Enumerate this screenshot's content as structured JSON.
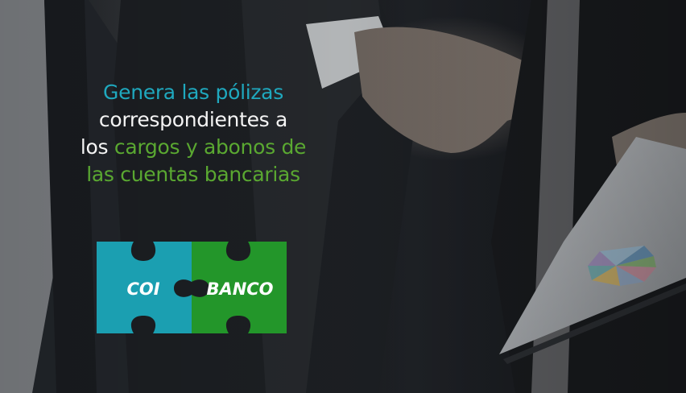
{
  "headline": {
    "line1_teal": "Genera las pólizas",
    "line2_white": "correspondientes a",
    "line3_white": "los ",
    "line3_green": "cargos y abonos de",
    "line4_green": "las cuentas bancarias"
  },
  "logo": {
    "left_label": "COI",
    "right_label": "BANCO"
  },
  "colors": {
    "teal": "#1fa8be",
    "green": "#5aa831",
    "puzzle_teal": "#1b9fb1",
    "puzzle_green": "#23962a"
  }
}
